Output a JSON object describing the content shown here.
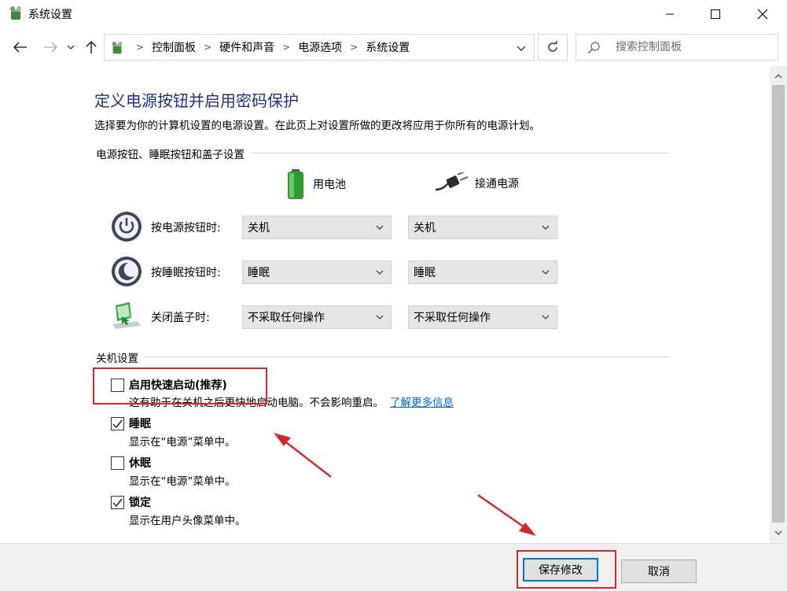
{
  "window": {
    "title": "系统设置",
    "icons": {
      "app": "control-panel-icon",
      "minimize": "minimize-icon",
      "maximize": "maximize-icon",
      "close": "close-icon"
    }
  },
  "address": {
    "breadcrumbs": [
      "控制面板",
      "硬件和声音",
      "电源选项",
      "系统设置"
    ],
    "search_placeholder": "搜索控制面板",
    "icons": {
      "back": "back-arrow-icon",
      "forward": "forward-arrow-icon",
      "recent": "chevron-down-icon",
      "up": "up-arrow-icon",
      "refresh": "refresh-icon",
      "search": "search-icon"
    }
  },
  "page": {
    "heading": "定义电源按钮并启用密码保护",
    "description": "选择要为你的计算机设置的电源设置。在此页上对设置所做的更改将应用于你所有的电源计划。"
  },
  "buttons_section": {
    "title": "电源按钮、睡眠按钮和盖子设置",
    "columns": [
      {
        "label": "用电池",
        "icon": "battery-icon"
      },
      {
        "label": "接通电源",
        "icon": "power-plug-icon"
      }
    ],
    "rows": [
      {
        "label": "按电源按钮时:",
        "icon": "power-button-icon",
        "battery": "关机",
        "plugged": "关机"
      },
      {
        "label": "按睡眠按钮时:",
        "icon": "sleep-button-icon",
        "battery": "睡眠",
        "plugged": "睡眠"
      },
      {
        "label": "关闭盖子时:",
        "icon": "laptop-lid-icon",
        "battery": "不采取任何操作",
        "plugged": "不采取任何操作"
      }
    ]
  },
  "shutdown_section": {
    "title": "关机设置",
    "options": [
      {
        "label": "启用快速启动(推荐)",
        "checked": false,
        "description": "这有助于在关机之后更快地启动电脑。不会影响重启。",
        "link": "了解更多信息"
      },
      {
        "label": "睡眠",
        "checked": true,
        "description": "显示在“电源”菜单中。"
      },
      {
        "label": "休眠",
        "checked": false,
        "description": "显示在“电源”菜单中。"
      },
      {
        "label": "锁定",
        "checked": true,
        "description": "显示在用户头像菜单中。"
      }
    ]
  },
  "footer": {
    "save": "保存修改",
    "cancel": "取消"
  },
  "colors": {
    "heading": "#1e3287",
    "link": "#0066cc",
    "annotation": "#d22a2a"
  }
}
